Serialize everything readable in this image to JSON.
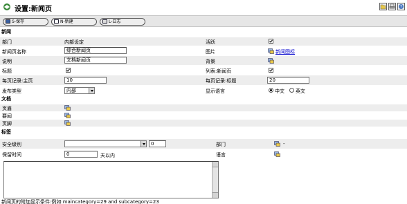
{
  "window": {
    "title": "设置:新闻页"
  },
  "toolbar": {
    "save_label": "S-保存",
    "new_label": "N-新建",
    "log_label": "L-日志"
  },
  "sections": {
    "news": "新闻",
    "document": "文档",
    "tags": "标签"
  },
  "news": {
    "department_label": "部门",
    "department_value": "内部设定",
    "active_label": "活跃",
    "active_checked": true,
    "name_label": "新闻页名称",
    "name_value": "综合新闻页",
    "image_label": "图片",
    "image_link": "新闻图标",
    "description_label": "说明",
    "description_value": "文档新闻页",
    "background_label": "背景",
    "title_label": "标题",
    "title_checked": true,
    "list_label": "列表:新闻页",
    "list_checked": true,
    "records_main_label": "每页记录:主页",
    "records_main_value": "10",
    "records_tag_label": "每页记录:标题",
    "records_tag_value": "20",
    "type_label": "发布类型",
    "type_value": "内部",
    "language_label": "显示语言",
    "language_options": [
      "中文",
      "英文"
    ],
    "language_selected": "中文"
  },
  "document": {
    "header_label": "页眉",
    "summary_label": "要闻",
    "footer_label": "页脚"
  },
  "tags": {
    "security_label": "安全级别",
    "security_number": "0",
    "department_label": "部门",
    "department_value": "-",
    "retention_label": "保留时间",
    "retention_value": "0",
    "retention_unit": "天以内",
    "language_label": "语言"
  },
  "footer": {
    "note": "新闻页的附加显示条件:例如:maincategory=29 and subcategory=23"
  }
}
